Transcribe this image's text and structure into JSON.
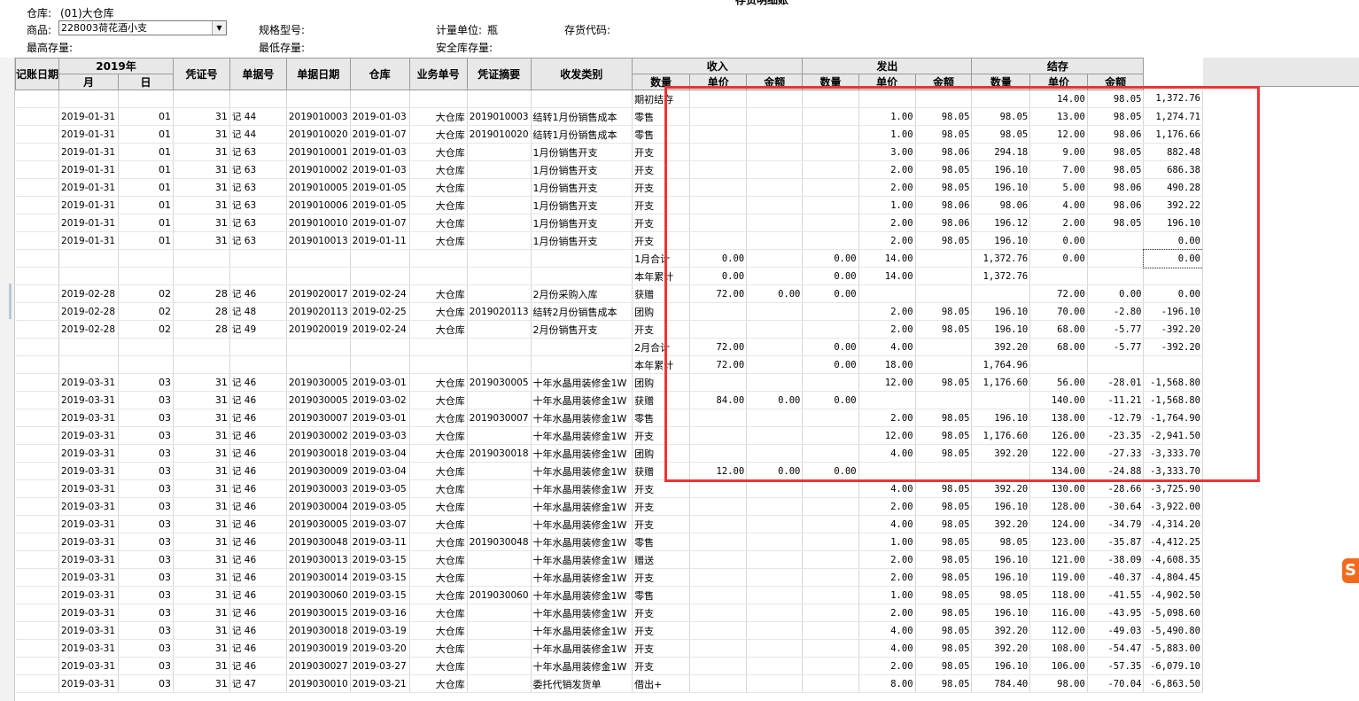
{
  "header": {
    "title_partial": "存货明细账",
    "warehouse_label": "仓库:",
    "warehouse_value": "(01)大仓库",
    "product_label": "商品:",
    "product_value": "228003荷花酒小支",
    "spec_label": "规格型号:",
    "unit_label": "计量单位:",
    "unit_value": "瓶",
    "code_label": "存货代码:",
    "max_stock_label": "最高存量:",
    "min_stock_label": "最低存量:",
    "safe_stock_label": "安全库存量:"
  },
  "columns": {
    "date": "记账日期",
    "year": "2019年",
    "month": "月",
    "day": "日",
    "voucher_no": "凭证号",
    "doc_no": "单据号",
    "doc_date": "单据日期",
    "warehouse": "仓库",
    "biz_no": "业务单号",
    "summary": "凭证摘要",
    "io_type": "收发类别",
    "in_group": "收入",
    "out_group": "发出",
    "bal_group": "结存",
    "qty": "数量",
    "price": "单价",
    "amount": "金额"
  },
  "rows": [
    [
      "",
      "",
      "",
      "",
      "",
      "",
      "",
      "",
      "",
      "期初结存",
      "",
      "",
      "",
      "",
      "",
      "",
      "14.00",
      "98.05",
      "1,372.76"
    ],
    [
      "2019-01-31",
      "01",
      "31",
      "记 44",
      "2019010003",
      "2019-01-03",
      "大仓库",
      "2019010003",
      "结转1月份销售成本",
      "零售",
      "",
      "",
      "",
      "1.00",
      "98.05",
      "98.05",
      "13.00",
      "98.05",
      "1,274.71"
    ],
    [
      "2019-01-31",
      "01",
      "31",
      "记 44",
      "2019010020",
      "2019-01-07",
      "大仓库",
      "2019010020",
      "结转1月份销售成本",
      "零售",
      "",
      "",
      "",
      "1.00",
      "98.05",
      "98.05",
      "12.00",
      "98.06",
      "1,176.66"
    ],
    [
      "2019-01-31",
      "01",
      "31",
      "记 63",
      "2019010001",
      "2019-01-03",
      "大仓库",
      "",
      "1月份销售开支",
      "开支",
      "",
      "",
      "",
      "3.00",
      "98.06",
      "294.18",
      "9.00",
      "98.05",
      "882.48"
    ],
    [
      "2019-01-31",
      "01",
      "31",
      "记 63",
      "2019010002",
      "2019-01-03",
      "大仓库",
      "",
      "1月份销售开支",
      "开支",
      "",
      "",
      "",
      "2.00",
      "98.05",
      "196.10",
      "7.00",
      "98.05",
      "686.38"
    ],
    [
      "2019-01-31",
      "01",
      "31",
      "记 63",
      "2019010005",
      "2019-01-05",
      "大仓库",
      "",
      "1月份销售开支",
      "开支",
      "",
      "",
      "",
      "2.00",
      "98.05",
      "196.10",
      "5.00",
      "98.06",
      "490.28"
    ],
    [
      "2019-01-31",
      "01",
      "31",
      "记 63",
      "2019010006",
      "2019-01-05",
      "大仓库",
      "",
      "1月份销售开支",
      "开支",
      "",
      "",
      "",
      "1.00",
      "98.06",
      "98.06",
      "4.00",
      "98.06",
      "392.22"
    ],
    [
      "2019-01-31",
      "01",
      "31",
      "记 63",
      "2019010010",
      "2019-01-07",
      "大仓库",
      "",
      "1月份销售开支",
      "开支",
      "",
      "",
      "",
      "2.00",
      "98.06",
      "196.12",
      "2.00",
      "98.05",
      "196.10"
    ],
    [
      "2019-01-31",
      "01",
      "31",
      "记 63",
      "2019010013",
      "2019-01-11",
      "大仓库",
      "",
      "1月份销售开支",
      "开支",
      "",
      "",
      "",
      "2.00",
      "98.05",
      "196.10",
      "0.00",
      "",
      "0.00"
    ],
    [
      "",
      "",
      "",
      "",
      "",
      "",
      "",
      "",
      "",
      "1月合计",
      "0.00",
      "",
      "0.00",
      "14.00",
      "",
      "1,372.76",
      "0.00",
      "",
      "0.00"
    ],
    [
      "",
      "",
      "",
      "",
      "",
      "",
      "",
      "",
      "",
      "本年累计",
      "0.00",
      "",
      "0.00",
      "14.00",
      "",
      "1,372.76",
      "",
      "",
      ""
    ],
    [
      "2019-02-28",
      "02",
      "28",
      "记 46",
      "2019020017",
      "2019-02-24",
      "大仓库",
      "",
      "2月份采购入库",
      "获赠",
      "72.00",
      "0.00",
      "0.00",
      "",
      "",
      "",
      "72.00",
      "0.00",
      "0.00"
    ],
    [
      "2019-02-28",
      "02",
      "28",
      "记 48",
      "2019020113",
      "2019-02-25",
      "大仓库",
      "2019020113",
      "结转2月份销售成本",
      "团购",
      "",
      "",
      "",
      "2.00",
      "98.05",
      "196.10",
      "70.00",
      "-2.80",
      "-196.10"
    ],
    [
      "2019-02-28",
      "02",
      "28",
      "记 49",
      "2019020019",
      "2019-02-24",
      "大仓库",
      "",
      "2月份销售开支",
      "开支",
      "",
      "",
      "",
      "2.00",
      "98.05",
      "196.10",
      "68.00",
      "-5.77",
      "-392.20"
    ],
    [
      "",
      "",
      "",
      "",
      "",
      "",
      "",
      "",
      "",
      "2月合计",
      "72.00",
      "",
      "0.00",
      "4.00",
      "",
      "392.20",
      "68.00",
      "-5.77",
      "-392.20"
    ],
    [
      "",
      "",
      "",
      "",
      "",
      "",
      "",
      "",
      "",
      "本年累计",
      "72.00",
      "",
      "0.00",
      "18.00",
      "",
      "1,764.96",
      "",
      "",
      ""
    ],
    [
      "2019-03-31",
      "03",
      "31",
      "记 46",
      "2019030005",
      "2019-03-01",
      "大仓库",
      "2019030005",
      "十年水晶用装修金1W",
      "团购",
      "",
      "",
      "",
      "12.00",
      "98.05",
      "1,176.60",
      "56.00",
      "-28.01",
      "-1,568.80"
    ],
    [
      "2019-03-31",
      "03",
      "31",
      "记 46",
      "2019030005",
      "2019-03-02",
      "大仓库",
      "",
      "十年水晶用装修金1W",
      "获赠",
      "84.00",
      "0.00",
      "0.00",
      "",
      "",
      "",
      "140.00",
      "-11.21",
      "-1,568.80"
    ],
    [
      "2019-03-31",
      "03",
      "31",
      "记 46",
      "2019030007",
      "2019-03-01",
      "大仓库",
      "2019030007",
      "十年水晶用装修金1W",
      "零售",
      "",
      "",
      "",
      "2.00",
      "98.05",
      "196.10",
      "138.00",
      "-12.79",
      "-1,764.90"
    ],
    [
      "2019-03-31",
      "03",
      "31",
      "记 46",
      "2019030002",
      "2019-03-03",
      "大仓库",
      "",
      "十年水晶用装修金1W",
      "开支",
      "",
      "",
      "",
      "12.00",
      "98.05",
      "1,176.60",
      "126.00",
      "-23.35",
      "-2,941.50"
    ],
    [
      "2019-03-31",
      "03",
      "31",
      "记 46",
      "2019030018",
      "2019-03-04",
      "大仓库",
      "2019030018",
      "十年水晶用装修金1W",
      "团购",
      "",
      "",
      "",
      "4.00",
      "98.05",
      "392.20",
      "122.00",
      "-27.33",
      "-3,333.70"
    ],
    [
      "2019-03-31",
      "03",
      "31",
      "记 46",
      "2019030009",
      "2019-03-04",
      "大仓库",
      "",
      "十年水晶用装修金1W",
      "获赠",
      "12.00",
      "0.00",
      "0.00",
      "",
      "",
      "",
      "134.00",
      "-24.88",
      "-3,333.70"
    ],
    [
      "2019-03-31",
      "03",
      "31",
      "记 46",
      "2019030003",
      "2019-03-05",
      "大仓库",
      "",
      "十年水晶用装修金1W",
      "开支",
      "",
      "",
      "",
      "4.00",
      "98.05",
      "392.20",
      "130.00",
      "-28.66",
      "-3,725.90"
    ],
    [
      "2019-03-31",
      "03",
      "31",
      "记 46",
      "2019030004",
      "2019-03-05",
      "大仓库",
      "",
      "十年水晶用装修金1W",
      "开支",
      "",
      "",
      "",
      "2.00",
      "98.05",
      "196.10",
      "128.00",
      "-30.64",
      "-3,922.00"
    ],
    [
      "2019-03-31",
      "03",
      "31",
      "记 46",
      "2019030005",
      "2019-03-07",
      "大仓库",
      "",
      "十年水晶用装修金1W",
      "开支",
      "",
      "",
      "",
      "4.00",
      "98.05",
      "392.20",
      "124.00",
      "-34.79",
      "-4,314.20"
    ],
    [
      "2019-03-31",
      "03",
      "31",
      "记 46",
      "2019030048",
      "2019-03-11",
      "大仓库",
      "2019030048",
      "十年水晶用装修金1W",
      "零售",
      "",
      "",
      "",
      "1.00",
      "98.05",
      "98.05",
      "123.00",
      "-35.87",
      "-4,412.25"
    ],
    [
      "2019-03-31",
      "03",
      "31",
      "记 46",
      "2019030013",
      "2019-03-15",
      "大仓库",
      "",
      "十年水晶用装修金1W",
      "赠送",
      "",
      "",
      "",
      "2.00",
      "98.05",
      "196.10",
      "121.00",
      "-38.09",
      "-4,608.35"
    ],
    [
      "2019-03-31",
      "03",
      "31",
      "记 46",
      "2019030014",
      "2019-03-15",
      "大仓库",
      "",
      "十年水晶用装修金1W",
      "开支",
      "",
      "",
      "",
      "2.00",
      "98.05",
      "196.10",
      "119.00",
      "-40.37",
      "-4,804.45"
    ],
    [
      "2019-03-31",
      "03",
      "31",
      "记 46",
      "2019030060",
      "2019-03-15",
      "大仓库",
      "2019030060",
      "十年水晶用装修金1W",
      "零售",
      "",
      "",
      "",
      "1.00",
      "98.05",
      "98.05",
      "118.00",
      "-41.55",
      "-4,902.50"
    ],
    [
      "2019-03-31",
      "03",
      "31",
      "记 46",
      "2019030015",
      "2019-03-16",
      "大仓库",
      "",
      "十年水晶用装修金1W",
      "开支",
      "",
      "",
      "",
      "2.00",
      "98.05",
      "196.10",
      "116.00",
      "-43.95",
      "-5,098.60"
    ],
    [
      "2019-03-31",
      "03",
      "31",
      "记 46",
      "2019030018",
      "2019-03-19",
      "大仓库",
      "",
      "十年水晶用装修金1W",
      "开支",
      "",
      "",
      "",
      "4.00",
      "98.05",
      "392.20",
      "112.00",
      "-49.03",
      "-5,490.80"
    ],
    [
      "2019-03-31",
      "03",
      "31",
      "记 46",
      "2019030019",
      "2019-03-20",
      "大仓库",
      "",
      "十年水晶用装修金1W",
      "开支",
      "",
      "",
      "",
      "4.00",
      "98.05",
      "392.20",
      "108.00",
      "-54.47",
      "-5,883.00"
    ],
    [
      "2019-03-31",
      "03",
      "31",
      "记 46",
      "2019030027",
      "2019-03-27",
      "大仓库",
      "",
      "十年水晶用装修金1W",
      "开支",
      "",
      "",
      "",
      "2.00",
      "98.05",
      "196.10",
      "106.00",
      "-57.35",
      "-6,079.10"
    ],
    [
      "2019-03-31",
      "03",
      "31",
      "记 47",
      "2019030010",
      "2019-03-21",
      "大仓库",
      "",
      "委托代销发货单",
      "借出+",
      "",
      "",
      "",
      "8.00",
      "98.05",
      "784.40",
      "98.00",
      "-70.04",
      "-6,863.50"
    ]
  ],
  "colors": {
    "highlight_border": "#ee3333",
    "header_bg": "#e8e8e8",
    "logo_bg": "#f26b1d"
  },
  "icons": {
    "combo_arrow": "▼",
    "logo_glyph": "S"
  }
}
